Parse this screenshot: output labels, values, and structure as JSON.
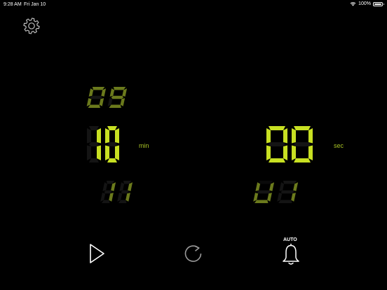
{
  "status_bar": {
    "time": "9:28 AM",
    "date": "Fri Jan 10",
    "battery_text": "100%",
    "battery_level": 1.0
  },
  "timer": {
    "minutes": {
      "prev": "09",
      "current": "10",
      "next": "11",
      "unit": "min"
    },
    "seconds": {
      "current": "00",
      "next": "01",
      "unit": "sec"
    }
  },
  "controls": {
    "alarm_mode_label": "AUTO"
  },
  "colors": {
    "digit_on": "#c8e022",
    "digit_dim": "#6b7a1c",
    "unit_text": "#a8c324"
  },
  "icons": {
    "settings": "gear-icon",
    "play": "play-icon",
    "reset": "refresh-icon",
    "alarm": "bell-icon",
    "wifi": "wifi-icon",
    "battery": "battery-icon"
  }
}
